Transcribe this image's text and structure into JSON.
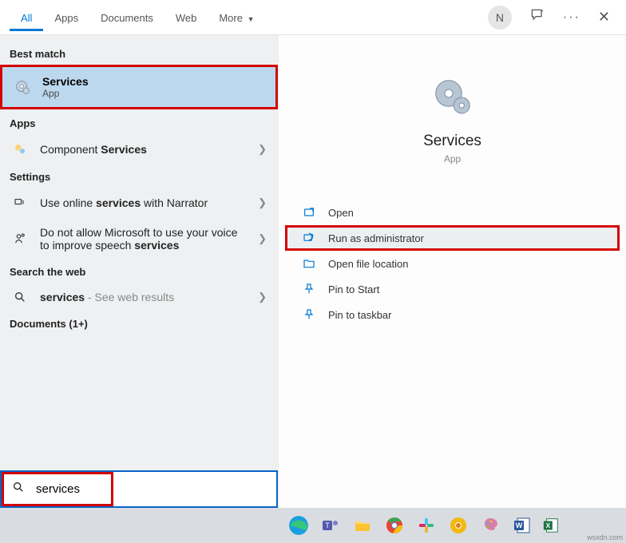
{
  "tabs": {
    "all": "All",
    "apps": "Apps",
    "documents": "Documents",
    "web": "Web",
    "more": "More"
  },
  "avatar_initial": "N",
  "left": {
    "best_match_label": "Best match",
    "best_match": {
      "title": "Services",
      "subtitle": "App"
    },
    "apps_label": "Apps",
    "apps_item_prefix": "Component ",
    "apps_item_bold": "Services",
    "settings_label": "Settings",
    "setting1_pre": "Use online ",
    "setting1_bold": "services",
    "setting1_post": " with Narrator",
    "setting2_pre": "Do not allow Microsoft to use your voice to improve speech ",
    "setting2_bold": "services",
    "search_web_label": "Search the web",
    "webrow_bold": "services",
    "webrow_suffix": " - See web results",
    "documents_label": "Documents (1+)"
  },
  "right": {
    "title": "Services",
    "subtitle": "App",
    "actions": {
      "open": "Open",
      "run_admin": "Run as administrator",
      "open_loc": "Open file location",
      "pin_start": "Pin to Start",
      "pin_taskbar": "Pin to taskbar"
    }
  },
  "search": {
    "value": "services"
  },
  "watermark": "wsxdn.com"
}
